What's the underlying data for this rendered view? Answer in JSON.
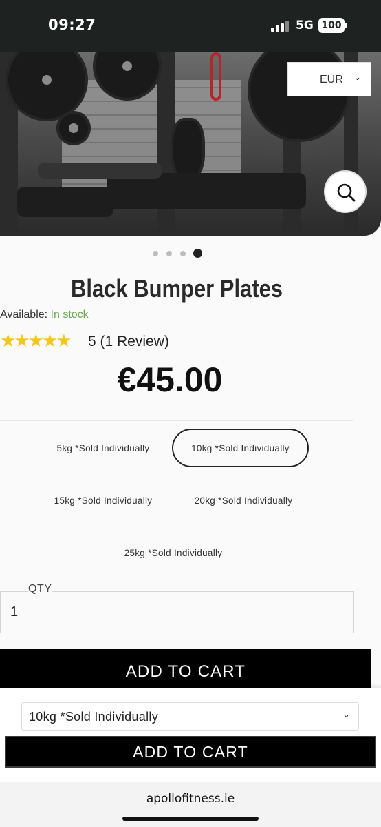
{
  "status_bar": {
    "time": "09:27",
    "network": "5G",
    "battery": "100"
  },
  "header": {
    "currency": "EUR"
  },
  "product": {
    "title": "Black Bumper Plates",
    "availability_label": "Available:",
    "availability_value": "In stock",
    "rating_stars": "★★★★★",
    "rating_value": 5,
    "rating_text": "5 (1 Review)",
    "price": "€45.00",
    "carousel": {
      "count": 4,
      "active_index": 3
    }
  },
  "variants": [
    {
      "label": "5kg *Sold Individually",
      "selected": false
    },
    {
      "label": "10kg *Sold Individually",
      "selected": true
    },
    {
      "label": "15kg *Sold Individually",
      "selected": false
    },
    {
      "label": "20kg *Sold Individually",
      "selected": false
    },
    {
      "label": "25kg *Sold Individually",
      "selected": false
    }
  ],
  "quantity": {
    "label": "QTY",
    "value": "1"
  },
  "buttons": {
    "add_to_cart": "ADD TO CART"
  },
  "sticky": {
    "selected_variant": "10kg *Sold Individually",
    "add_to_cart": "ADD TO CART"
  },
  "browser": {
    "url": "apollofitness.ie"
  },
  "colors": {
    "in_stock": "#6aa84f",
    "stars": "#f5c518",
    "button": "#000000"
  }
}
